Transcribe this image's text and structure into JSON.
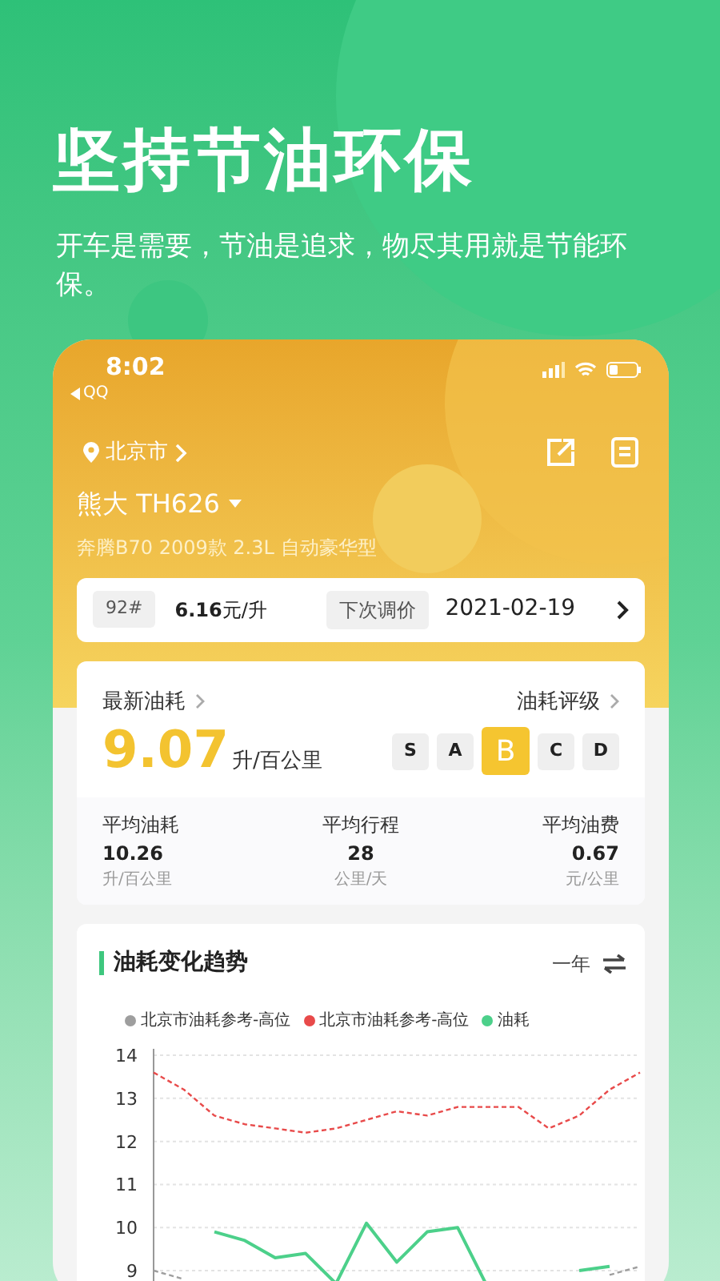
{
  "headline": "坚持节油环保",
  "tagline": "开车是需要，节油是追求，物尽其用就是节能环保。",
  "phone": {
    "status_bar": {
      "time": "8:02",
      "back_label": "QQ"
    },
    "location": "北京市",
    "car_name": "熊大 TH626",
    "car_model": "奔腾B70 2009款 2.3L 自动豪华型",
    "fuel_price": {
      "grade": "92#",
      "price": "6.16",
      "unit": "元/升",
      "next_label": "下次调价",
      "next_date": "2021-02-19"
    },
    "consumption": {
      "title": "最新油耗",
      "rating_title": "油耗评级",
      "value": "9.07",
      "unit": "升/百公里",
      "grades": [
        {
          "label": "S",
          "selected": false
        },
        {
          "label": "A",
          "selected": false
        },
        {
          "label": "B",
          "selected": true
        },
        {
          "label": "C",
          "selected": false
        },
        {
          "label": "D",
          "selected": false
        }
      ],
      "stats": [
        {
          "label": "平均油耗",
          "value": "10.26",
          "unit": "升/百公里"
        },
        {
          "label": "平均行程",
          "value": "28",
          "unit": "公里/天"
        },
        {
          "label": "平均油费",
          "value": "0.67",
          "unit": "元/公里"
        }
      ]
    },
    "trend": {
      "title": "油耗变化趋势",
      "period": "一年",
      "chart_data": {
        "type": "line",
        "ylim": [
          8.5,
          14
        ],
        "yticks": [
          9,
          10,
          11,
          12,
          13,
          14
        ],
        "grid": true,
        "series": [
          {
            "name": "北京市油耗参考-高位",
            "color": "#9e9e9e",
            "line_style": "dashed",
            "values": [
              9.0,
              8.8,
              null,
              null,
              null,
              null,
              null,
              null,
              null,
              null,
              null,
              null,
              null,
              null,
              null,
              8.9,
              9.1
            ]
          },
          {
            "name": "北京市油耗参考-高位",
            "color": "#e84a4a",
            "line_style": "dashed",
            "values": [
              13.6,
              13.2,
              12.6,
              12.4,
              12.3,
              12.2,
              12.3,
              12.5,
              12.7,
              12.6,
              12.8,
              12.8,
              12.8,
              12.3,
              12.6,
              13.2,
              13.6
            ]
          },
          {
            "name": "油耗",
            "color": "#4cd08a",
            "line_style": "solid",
            "values": [
              null,
              null,
              9.9,
              9.7,
              9.3,
              9.4,
              8.7,
              10.1,
              9.2,
              9.9,
              10.0,
              8.6,
              null,
              null,
              9.0,
              9.1,
              null
            ]
          }
        ]
      }
    }
  }
}
